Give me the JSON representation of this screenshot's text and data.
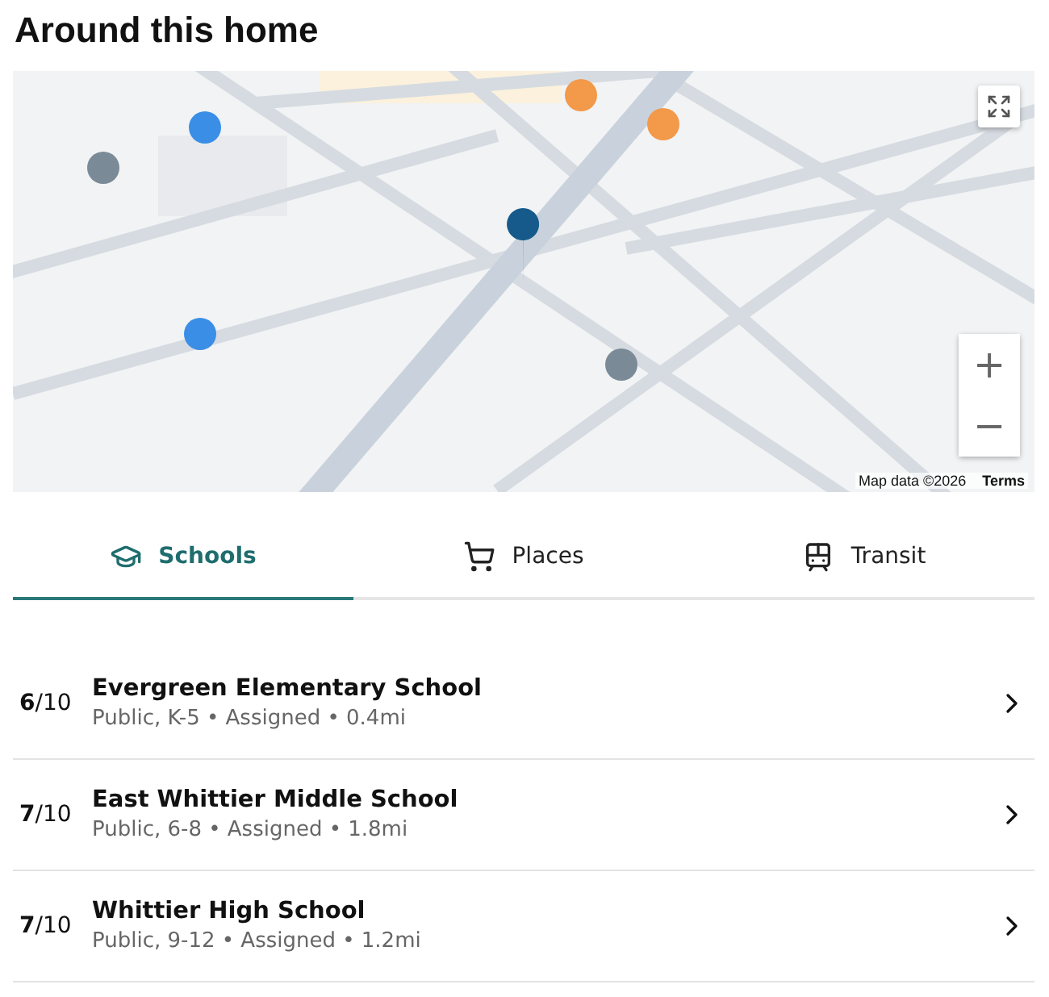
{
  "title": "Around this home",
  "map": {
    "kind": "picture",
    "attribution": "Map data ©2026",
    "terms": "Terms",
    "zoom_in": "+",
    "zoom_out": "−"
  },
  "tabs": [
    {
      "label": "Schools",
      "selected": true
    },
    {
      "label": "Places",
      "selected": false
    },
    {
      "label": "Transit",
      "selected": false
    }
  ],
  "schools": [
    {
      "rating": "**6**/10",
      "name": "Evergreen Elementary School",
      "details": "Public, K-5 • Assigned • 0.4mi"
    },
    {
      "rating": "**7**/10",
      "name": "East Whittier Middle School",
      "details": "Public, 6-8 • Assigned • 1.8mi"
    },
    {
      "rating": "**7**/10",
      "name": "Whittier High School",
      "details": "Public, 9-12 • Assigned • 1.2mi"
    }
  ]
}
